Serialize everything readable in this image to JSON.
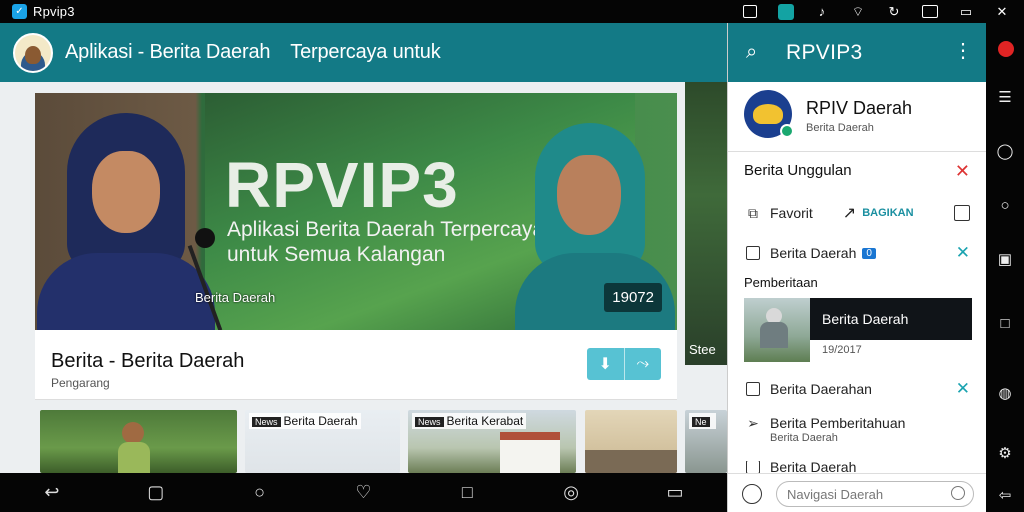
{
  "status_bar": {
    "app_name": "Rpvip3",
    "icons": [
      "screen-icon",
      "app-teal-icon",
      "bell-icon",
      "wifi-icon",
      "sync-icon",
      "window-icon",
      "battery-icon",
      "mute-icon"
    ]
  },
  "appbar": {
    "title": "Aplikasi - Berita Daerah",
    "subtitle": "Terpercaya untuk"
  },
  "hero": {
    "banner_title": "RPVIP3",
    "banner_line1": "Aplikasi Berita Daerah Terpercaya",
    "banner_line2": "untuk Semua Kalangan",
    "caption_left": "Berita Daerah",
    "caption_right": "19072"
  },
  "side_peek": {
    "text": "Stee"
  },
  "info_card": {
    "headline": "Berita - Berita Daerah",
    "meta": "Pengarang",
    "action_icons": [
      "download-icon",
      "share-icon"
    ]
  },
  "thumbs": [
    {
      "tag": "",
      "label": ""
    },
    {
      "tag": "News",
      "label": "Berita Daerah"
    },
    {
      "tag": "News",
      "label": "Berita Kerabat"
    },
    {
      "tag": "Ne",
      "label": ""
    }
  ],
  "navbar": {
    "icons": [
      "back-icon",
      "home-icon",
      "search-icon",
      "heart-icon",
      "square-icon",
      "explore-icon",
      "recents-icon"
    ]
  },
  "panel": {
    "title": "RPVIP3",
    "profile_name": "RPIV Daerah",
    "profile_sub": "Berita Daerah",
    "section_title": "Berita Unggulan",
    "row1_label": "Favorit",
    "row1_action": "BAGIKAN",
    "row2_label": "Berita Daerah",
    "row2_count": "0",
    "section2_title": "Pemberitaan",
    "news_caption": "Berita Daerah",
    "news_date": "19/2017",
    "row3_label": "Berita Daerahan",
    "row4_label": "Berita Pemberitahuan",
    "row4_sub": "Berita Daerah",
    "row5_label": "Berita Daerah",
    "search_placeholder": "Navigasi Daerah"
  },
  "rail": {
    "icons": [
      "notification-icon",
      "menu-icon",
      "chat-icon",
      "circle-icon",
      "save-icon",
      "square-icon",
      "lock-icon",
      "settings-icon",
      "back-arrow-icon"
    ]
  },
  "colors": {
    "primary": "#137a86",
    "accent": "#57c2d3",
    "close_red": "#d33333",
    "teal_x": "#1aa3b0"
  }
}
